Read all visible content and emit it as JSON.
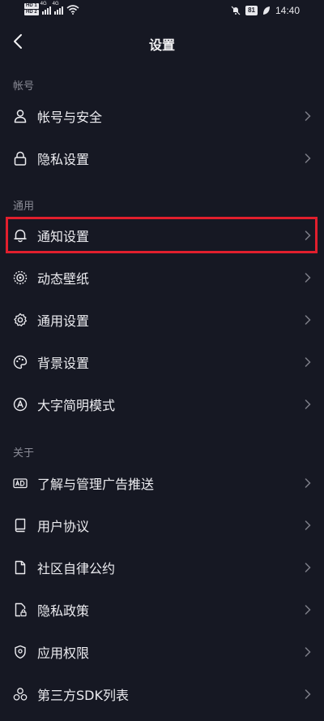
{
  "status_bar": {
    "hd1": "HD 1",
    "hd2": "HD 2",
    "net1": "4G",
    "net2": "4G",
    "battery": "81",
    "time": "14:40"
  },
  "header": {
    "title": "设置"
  },
  "sections": [
    {
      "label": "帐号",
      "items": [
        {
          "label": "帐号与安全",
          "icon": "user-icon"
        },
        {
          "label": "隐私设置",
          "icon": "lock-icon"
        }
      ]
    },
    {
      "label": "通用",
      "items": [
        {
          "label": "通知设置",
          "icon": "bell-icon",
          "highlighted": true
        },
        {
          "label": "动态壁纸",
          "icon": "live-wallpaper-icon"
        },
        {
          "label": "通用设置",
          "icon": "gear-icon"
        },
        {
          "label": "背景设置",
          "icon": "palette-icon"
        },
        {
          "label": "大字简明模式",
          "icon": "font-a-icon"
        }
      ]
    },
    {
      "label": "关于",
      "items": [
        {
          "label": "了解与管理广告推送",
          "icon": "ad-icon"
        },
        {
          "label": "用户协议",
          "icon": "book-icon"
        },
        {
          "label": "社区自律公约",
          "icon": "document-icon"
        },
        {
          "label": "隐私政策",
          "icon": "privacy-doc-icon"
        },
        {
          "label": "应用权限",
          "icon": "shield-icon"
        },
        {
          "label": "第三方SDK列表",
          "icon": "sdk-icon"
        }
      ]
    }
  ],
  "colors": {
    "background": "#161823",
    "highlight_border": "#e11f2d",
    "section_label": "#8a8b96"
  }
}
